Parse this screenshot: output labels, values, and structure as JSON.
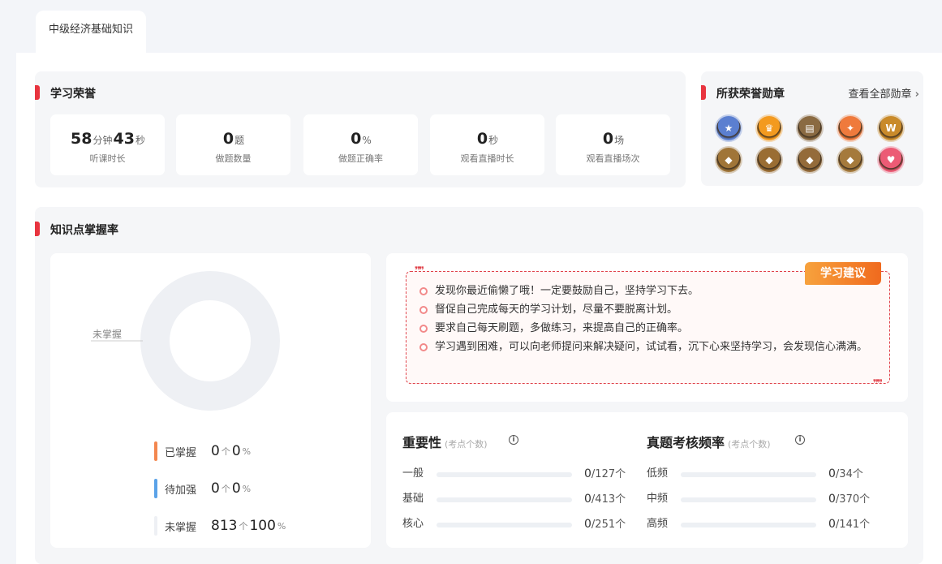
{
  "tab": {
    "label": "中级经济基础知识"
  },
  "honor": {
    "title": "学习荣誉",
    "stats": [
      {
        "parts": [
          {
            "num": "58",
            "unit": "分钟"
          },
          {
            "num": "43",
            "unit": "秒"
          }
        ],
        "label": "听课时长"
      },
      {
        "parts": [
          {
            "num": "0",
            "unit": "题"
          }
        ],
        "label": "做题数量"
      },
      {
        "parts": [
          {
            "num": "0",
            "unit": "%"
          }
        ],
        "label": "做题正确率"
      },
      {
        "parts": [
          {
            "num": "0",
            "unit": "秒"
          }
        ],
        "label": "观看直播时长"
      },
      {
        "parts": [
          {
            "num": "0",
            "unit": "场"
          }
        ],
        "label": "观看直播场次"
      }
    ]
  },
  "badges": {
    "title": "所获荣誉勋章",
    "view_all": "查看全部勋章",
    "items": [
      {
        "icon": "star-medal-icon",
        "color": "#5b7fd0",
        "glyph": "★"
      },
      {
        "icon": "orange-medal-icon",
        "color": "#f39a1f",
        "glyph": "♛"
      },
      {
        "icon": "book-medal-icon",
        "color": "#8a6a42",
        "glyph": "▤"
      },
      {
        "icon": "rocket-medal-icon",
        "color": "#ef7a3c",
        "glyph": "✦"
      },
      {
        "icon": "w-medal-icon",
        "color": "#c98a2a",
        "glyph": "W"
      },
      {
        "icon": "bronze-shield-1-icon",
        "color": "#a07538",
        "glyph": "◆"
      },
      {
        "icon": "bronze-shield-2-icon",
        "color": "#9a6d33",
        "glyph": "◆"
      },
      {
        "icon": "bronze-shield-3-icon",
        "color": "#946b3a",
        "glyph": "◆"
      },
      {
        "icon": "bronze-shield-4-icon",
        "color": "#a57a3c",
        "glyph": "◆"
      },
      {
        "icon": "pink-medal-icon",
        "color": "#ec5b75",
        "glyph": "♥"
      }
    ]
  },
  "mastery": {
    "title": "知识点掌握率",
    "donut_label": "未掌握",
    "legend": [
      {
        "name": "已掌握",
        "count": "0",
        "count_unit": "个",
        "pct": "0",
        "pct_unit": "%",
        "color": "#f3874f"
      },
      {
        "name": "待加强",
        "count": "0",
        "count_unit": "个",
        "pct": "0",
        "pct_unit": "%",
        "color": "#5aa2e8"
      },
      {
        "name": "未掌握",
        "count": "813",
        "count_unit": "个",
        "pct": "100",
        "pct_unit": "%",
        "color": "#eef0f4"
      }
    ],
    "chart_data": {
      "type": "pie",
      "categories": [
        "已掌握",
        "待加强",
        "未掌握"
      ],
      "values": [
        0,
        0,
        813
      ]
    }
  },
  "advice": {
    "tag": "学习建议",
    "items": [
      "发现你最近偷懒了哦！一定要鼓励自己，坚持学习下去。",
      "督促自己完成每天的学习计划，尽量不要脱离计划。",
      "要求自己每天刷题，多做练习，来提高自己的正确率。",
      "学习遇到困难，可以向老师提问来解决疑问，试试看，沉下心来坚持学习，会发现信心满满。"
    ]
  },
  "importance": {
    "title": "重要性",
    "sub": "(考点个数)",
    "rows": [
      {
        "label": "一般",
        "done": 0,
        "total": 127,
        "text_done": "0",
        "text_total": "/127个"
      },
      {
        "label": "基础",
        "done": 0,
        "total": 413,
        "text_done": "0",
        "text_total": "/413个"
      },
      {
        "label": "核心",
        "done": 0,
        "total": 251,
        "text_done": "0",
        "text_total": "/251个"
      }
    ]
  },
  "frequency": {
    "title": "真题考核频率",
    "sub": "(考点个数)",
    "rows": [
      {
        "label": "低频",
        "done": 0,
        "total": 34,
        "text_done": "0",
        "text_total": "/34个"
      },
      {
        "label": "中频",
        "done": 0,
        "total": 370,
        "text_done": "0",
        "text_total": "/370个"
      },
      {
        "label": "高频",
        "done": 0,
        "total": 141,
        "text_done": "0",
        "text_total": "/141个"
      }
    ]
  }
}
